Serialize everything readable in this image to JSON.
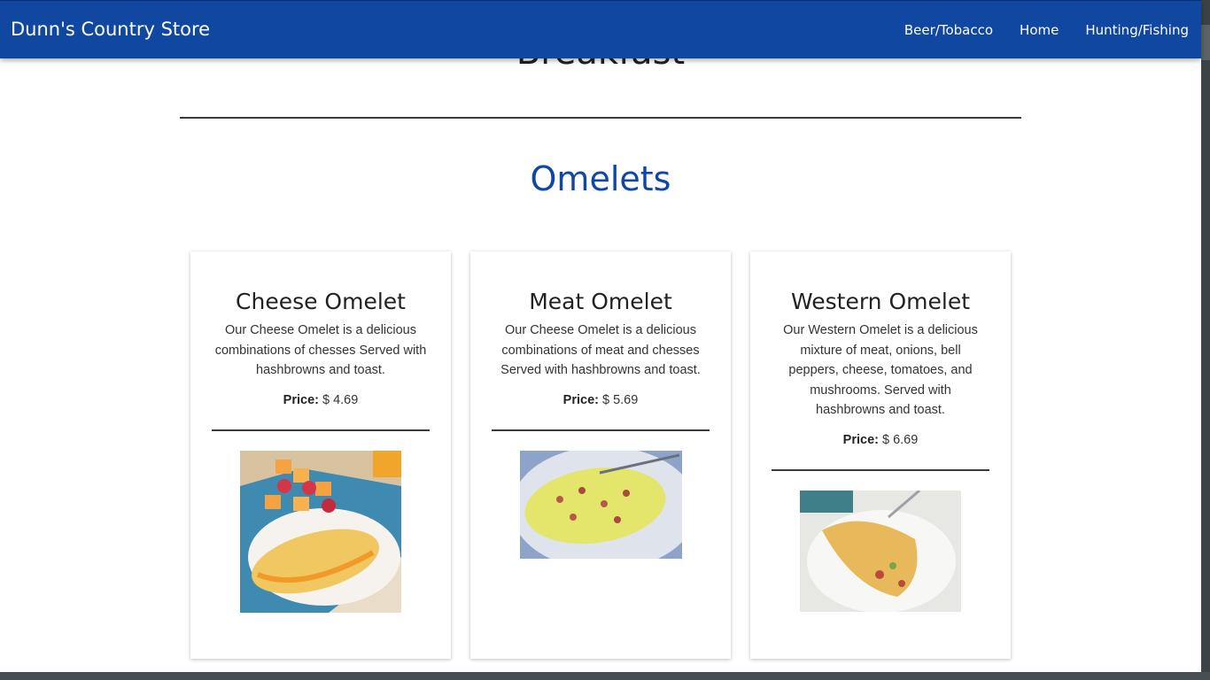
{
  "navbar": {
    "brand": "Dunn's Country Store",
    "links": [
      "Beer/Tobacco",
      "Home",
      "Hunting/Fishing"
    ]
  },
  "page": {
    "heading": "Breakfast",
    "section_title": "Omelets"
  },
  "cards": [
    {
      "title": "Cheese Omelet",
      "description": "Our Cheese Omelet is a delicious combinations of chesses Served with hashbrowns and toast.",
      "price_label": "Price:",
      "price": "$ 4.69"
    },
    {
      "title": "Meat Omelet",
      "description": "Our Cheese Omelet is a delicious combinations of meat and chesses Served with hashbrowns and toast.",
      "price_label": "Price:",
      "price": "$ 5.69"
    },
    {
      "title": "Western Omelet",
      "description": "Our Western Omelet is a delicious mixture of meat, onions, bell peppers, cheese, tomatoes, and mushrooms. Served with hashbrowns and toast.",
      "price_label": "Price:",
      "price": "$ 6.69"
    }
  ],
  "colors": {
    "navbar": "#0f47a1",
    "section_title": "#1047a6"
  }
}
